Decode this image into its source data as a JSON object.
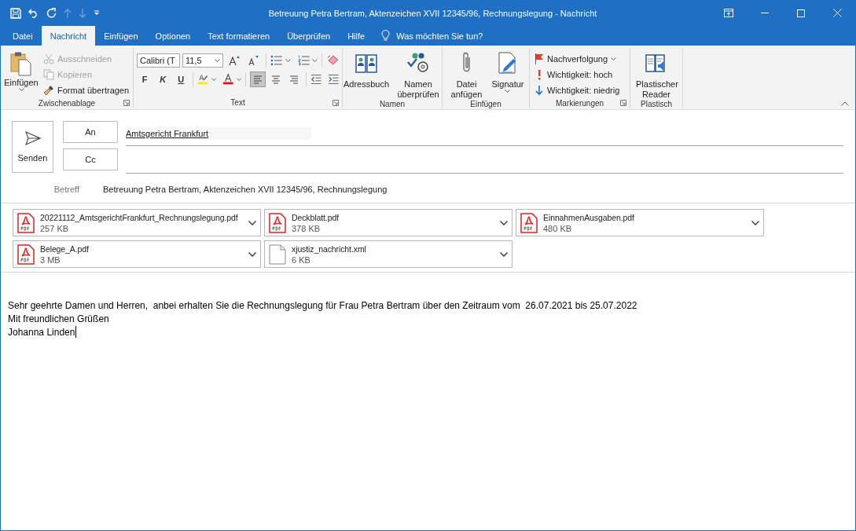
{
  "window": {
    "title": "Betreuung Petra Bertram, Aktenzeichen XVII 12345/96, Rechnungslegung  -  Nachricht",
    "quick_access": [
      {
        "kind": "save",
        "disabled": false
      },
      {
        "kind": "undo",
        "disabled": false
      },
      {
        "kind": "redo",
        "disabled": false
      },
      {
        "kind": "up",
        "disabled": true
      },
      {
        "kind": "down",
        "disabled": true
      },
      {
        "kind": "customize",
        "disabled": false
      }
    ]
  },
  "tabs": [
    {
      "label": "Datei",
      "selected": false
    },
    {
      "label": "Nachricht",
      "selected": true
    },
    {
      "label": "Einfügen",
      "selected": false
    },
    {
      "label": "Optionen",
      "selected": false
    },
    {
      "label": "Text formatieren",
      "selected": false
    },
    {
      "label": "Überprüfen",
      "selected": false
    },
    {
      "label": "Hilfe",
      "selected": false
    }
  ],
  "tell_me": "Was möchten Sie tun?",
  "ribbon": {
    "clipboard": {
      "label": "Zwischenablage",
      "paste": "Einfügen",
      "cut": {
        "label": "Ausschneiden",
        "disabled": true
      },
      "copy": {
        "label": "Kopieren",
        "disabled": true
      },
      "format_painter": {
        "label": "Format übertragen",
        "disabled": false
      }
    },
    "text": {
      "label": "Text",
      "font": "Calibri (T",
      "size": "11,5",
      "bold": "F",
      "italic": "K",
      "underline": "U",
      "align": [
        {
          "selected": true
        },
        {
          "selected": false
        },
        {
          "selected": false
        }
      ]
    },
    "names": {
      "label": "Namen",
      "address_book": "Adressbuch",
      "check_names": "Namen überprüfen"
    },
    "insert": {
      "label": "Einfügen",
      "attach_file": "Datei anfügen",
      "signature": "Signatur"
    },
    "tags": {
      "label": "Markierungen",
      "follow_up": "Nachverfolgung",
      "high": "Wichtigkeit: hoch",
      "low": "Wichtigkeit: niedrig"
    },
    "immersive": {
      "label": "Plastisch",
      "reader": "Plastischer Reader"
    }
  },
  "header": {
    "send": "Senden",
    "to_button": "An",
    "to": "Amtsgericht Frankfurt",
    "cc_button": "Cc",
    "subject_label": "Betreff",
    "subject": "Betreuung Petra Bertram, Aktenzeichen XVII 12345/96, Rechnungslegung"
  },
  "attachments": [
    {
      "kind": "pdf",
      "name": "20221112_AmtsgerichtFrankfurt_Rechnungslegung.pdf",
      "size": "257 KB"
    },
    {
      "kind": "pdf",
      "name": "Deckblatt.pdf",
      "size": "378 KB"
    },
    {
      "kind": "pdf",
      "name": "EinnahmenAusgaben.pdf",
      "size": "480 KB"
    },
    {
      "kind": "pdf",
      "name": "Belege_A.pdf",
      "size": "3 MB"
    },
    {
      "kind": "file",
      "name": "xjustiz_nachricht.xml",
      "size": "6 KB"
    }
  ],
  "body": {
    "lines": [
      "Sehr geehrte Damen und Herren,  anbei erhalten Sie die Rechnungslegung für Frau Petra Bertram über den Zeitraum vom  26.07.2021 bis 25.07.2022",
      "Mit freundlichen Grüßen",
      "Johanna Linden"
    ]
  }
}
